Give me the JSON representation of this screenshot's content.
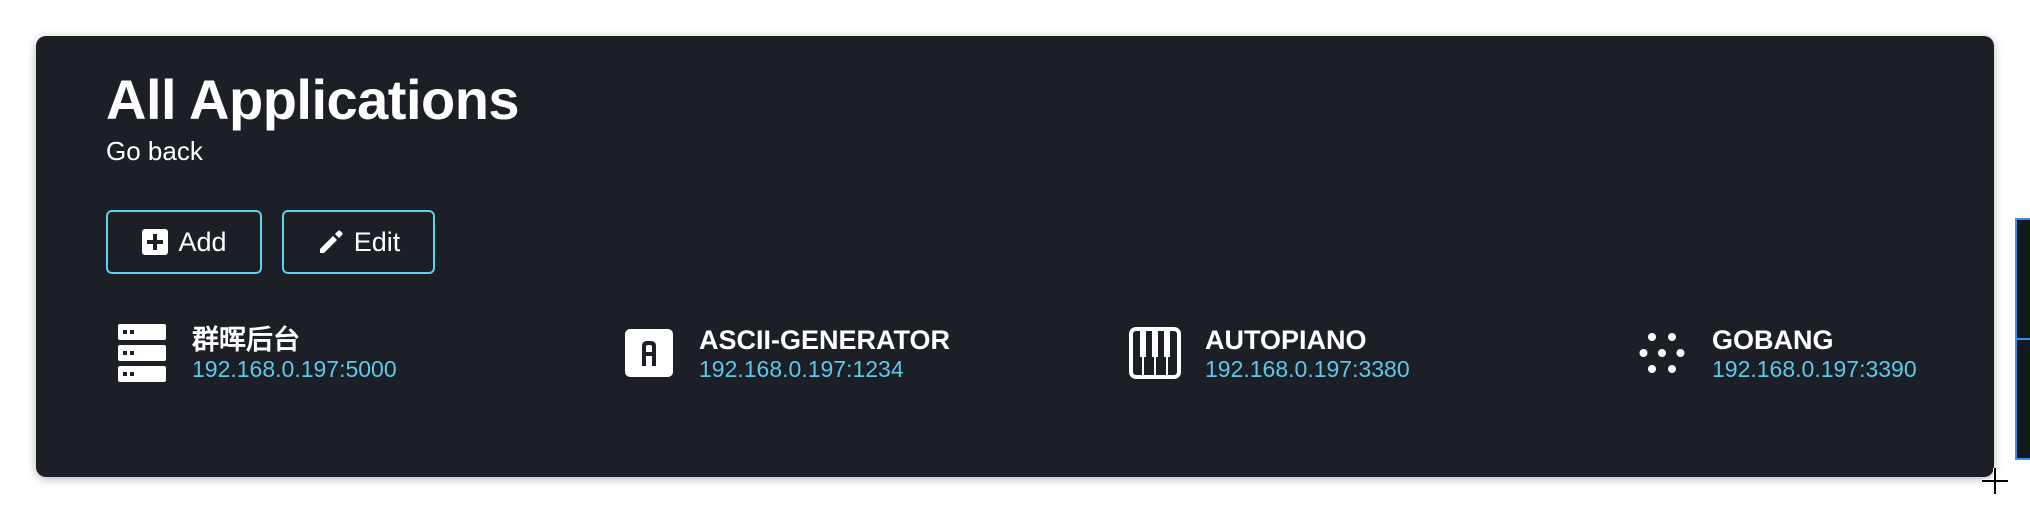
{
  "header": {
    "title": "All Applications",
    "go_back": "Go back"
  },
  "toolbar": {
    "add_label": "Add",
    "edit_label": "Edit"
  },
  "apps": [
    {
      "name": "群晖后台",
      "address": "192.168.0.197:5000",
      "icon": "server-icon"
    },
    {
      "name": "ASCII-GENERATOR",
      "address": "192.168.0.197:1234",
      "icon": "letter-a-icon"
    },
    {
      "name": "AUTOPIANO",
      "address": "192.168.0.197:3380",
      "icon": "piano-keys-icon"
    },
    {
      "name": "GOBANG",
      "address": "192.168.0.197:3390",
      "icon": "dots-icon"
    }
  ],
  "colors": {
    "panel_bg": "#1c1f25",
    "accent": "#5fd0ee",
    "address_text": "#5fc8ea",
    "text": "#ffffff"
  }
}
